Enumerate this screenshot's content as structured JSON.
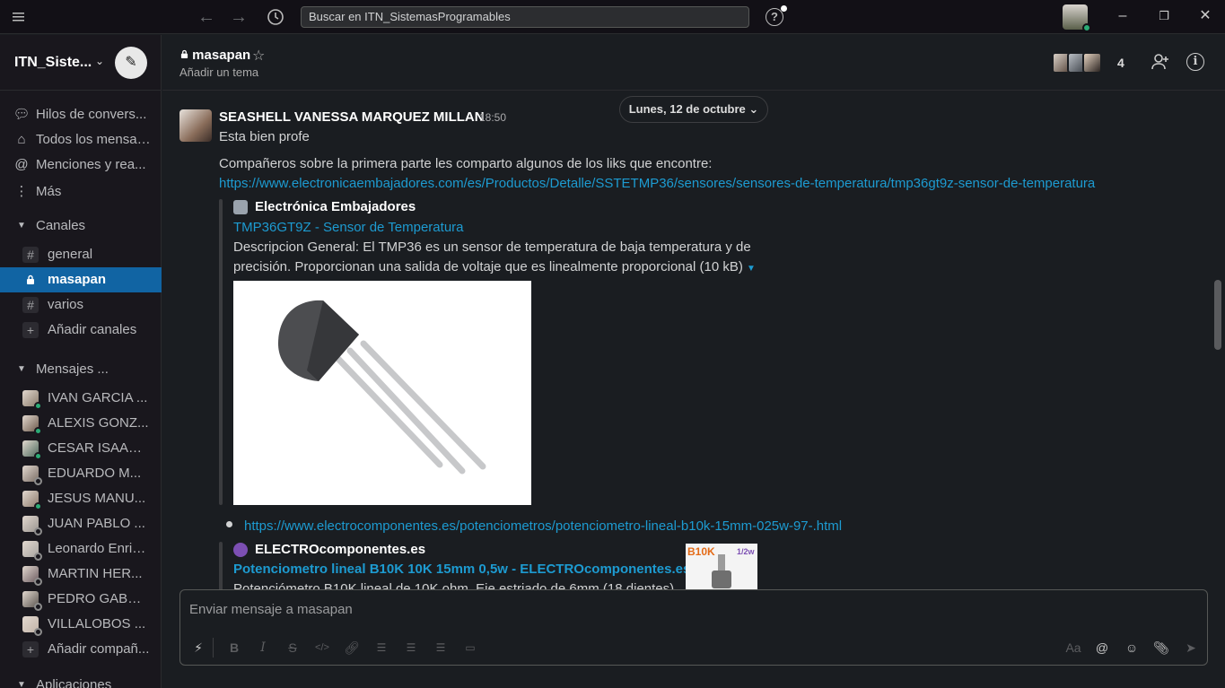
{
  "search": {
    "placeholder": "Buscar en ITN_SistemasProgramables"
  },
  "workspace": {
    "name": "ITN_Siste..."
  },
  "sidebar": {
    "nav": [
      {
        "label": "Hilos de convers...",
        "icon": "threads-icon"
      },
      {
        "label": "Todos los mensaj...",
        "icon": "all-dms-icon"
      },
      {
        "label": "Menciones y rea...",
        "icon": "at-icon"
      },
      {
        "label": "Más",
        "icon": "more-icon"
      }
    ],
    "channels_section": "Canales",
    "channels": [
      {
        "label": "general",
        "icon": "#"
      },
      {
        "label": "masapan",
        "icon": "lock"
      },
      {
        "label": "varios",
        "icon": "#"
      },
      {
        "label": "Añadir canales",
        "icon": "+"
      }
    ],
    "dms_section": "Mensajes ...",
    "dms": [
      {
        "label": "IVAN GARCIA ...",
        "status": "on"
      },
      {
        "label": "ALEXIS GONZ...",
        "status": "on"
      },
      {
        "label": "CESAR ISAAC ...",
        "status": "on"
      },
      {
        "label": "EDUARDO M...",
        "status": "off"
      },
      {
        "label": "JESUS MANU...",
        "status": "on"
      },
      {
        "label": "JUAN PABLO ...",
        "status": "off"
      },
      {
        "label": "Leonardo Enriq...",
        "status": "off"
      },
      {
        "label": "MARTIN HER...",
        "status": "off"
      },
      {
        "label": "PEDRO GABRI...",
        "status": "off"
      },
      {
        "label": "VILLALOBOS ...",
        "status": "off"
      }
    ],
    "add_people": "Añadir compañ...",
    "apps_section": "Aplicaciones"
  },
  "channel": {
    "name": "masapan",
    "topic": "Añadir un tema",
    "member_count": "4"
  },
  "date_divider": "Lunes, 12 de octubre",
  "message": {
    "author": "SEASHELL VANESSA MARQUEZ MILLAN",
    "time": "18:50",
    "line1": "Esta bien profe",
    "line2": "Compañeros sobre la primera parte les comparto algunos de los liks que encontre:",
    "link1": "https://www.electronicaembajadores.com/es/Productos/Detalle/SSTETMP36/sensores/sensores-de-temperatura/tmp36gt9z-sensor-de-temperatura",
    "unfurl1": {
      "site": "Electrónica Embajadores",
      "title": "TMP36GT9Z - Sensor de Temperatura",
      "desc1": "Descripcion General: El TMP36 es un sensor de temperatura de baja temperatura y de",
      "desc2": "precisión. Proporcionan una salida de voltaje que es linealmente proporcional (10 kB)"
    },
    "link2": "https://www.electrocomponentes.es/potenciometros/potenciometro-lineal-b10k-15mm-025w-97-.html",
    "unfurl2": {
      "site": "ELECTROcomponentes.es",
      "title": "Potenciometro lineal B10K 10K 15mm 0,5w - ELECTROcomponentes.es",
      "desc": "Potenciómetro B10K lineal de 10K ohm. Eje estriado de 6mm (18 dientes)",
      "thumb_label": "B10K",
      "thumb_label2": "1/2w"
    }
  },
  "composer": {
    "placeholder": "Enviar mensaje a masapan",
    "aa": "Aa"
  },
  "colors": {
    "accent": "#1164a3",
    "link": "#1d9bd1",
    "online": "#2bac76"
  }
}
